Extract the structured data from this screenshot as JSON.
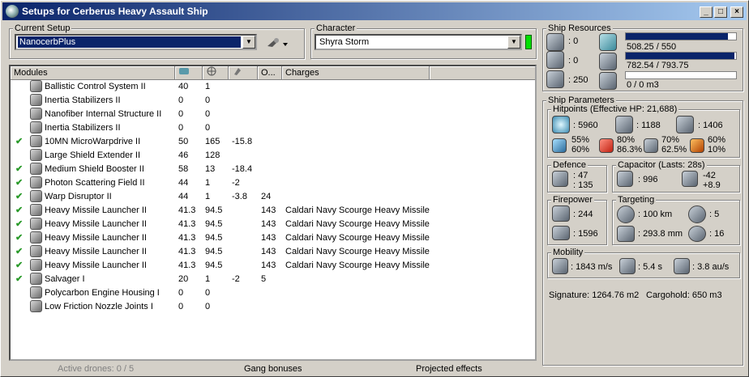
{
  "window": {
    "title": "Setups for Cerberus Heavy Assault Ship",
    "min": "_",
    "max": "□",
    "close": "×"
  },
  "setup": {
    "label": "Current Setup",
    "value": "NanocerbPlus"
  },
  "character": {
    "label": "Character",
    "value": "Shyra Storm"
  },
  "columns": {
    "modules": "Modules",
    "c1": "",
    "c2": "",
    "c3": "",
    "c4": "O...",
    "charges": "Charges"
  },
  "modules": [
    {
      "check": "",
      "name": "Ballistic Control System II",
      "cpu": "40",
      "pg": "1",
      "cap": "",
      "opt": "",
      "charge": ""
    },
    {
      "check": "",
      "name": "Inertia Stabilizers II",
      "cpu": "0",
      "pg": "0",
      "cap": "",
      "opt": "",
      "charge": ""
    },
    {
      "check": "",
      "name": "Nanofiber Internal Structure II",
      "cpu": "0",
      "pg": "0",
      "cap": "",
      "opt": "",
      "charge": ""
    },
    {
      "check": "",
      "name": "Inertia Stabilizers II",
      "cpu": "0",
      "pg": "0",
      "cap": "",
      "opt": "",
      "charge": ""
    },
    {
      "check": "✔",
      "name": "10MN MicroWarpdrive II",
      "cpu": "50",
      "pg": "165",
      "cap": "-15.8",
      "opt": "",
      "charge": ""
    },
    {
      "check": "",
      "name": "Large Shield Extender II",
      "cpu": "46",
      "pg": "128",
      "cap": "",
      "opt": "",
      "charge": ""
    },
    {
      "check": "✔",
      "name": "Medium Shield Booster II",
      "cpu": "58",
      "pg": "13",
      "cap": "-18.4",
      "opt": "",
      "charge": ""
    },
    {
      "check": "✔",
      "name": "Photon Scattering Field II",
      "cpu": "44",
      "pg": "1",
      "cap": "-2",
      "opt": "",
      "charge": ""
    },
    {
      "check": "✔",
      "name": "Warp Disruptor II",
      "cpu": "44",
      "pg": "1",
      "cap": "-3.8",
      "opt": "24",
      "charge": ""
    },
    {
      "check": "✔",
      "name": "Heavy Missile Launcher II",
      "cpu": "41.3",
      "pg": "94.5",
      "cap": "",
      "opt": "143",
      "charge": "Caldari Navy Scourge Heavy Missile"
    },
    {
      "check": "✔",
      "name": "Heavy Missile Launcher II",
      "cpu": "41.3",
      "pg": "94.5",
      "cap": "",
      "opt": "143",
      "charge": "Caldari Navy Scourge Heavy Missile"
    },
    {
      "check": "✔",
      "name": "Heavy Missile Launcher II",
      "cpu": "41.3",
      "pg": "94.5",
      "cap": "",
      "opt": "143",
      "charge": "Caldari Navy Scourge Heavy Missile"
    },
    {
      "check": "✔",
      "name": "Heavy Missile Launcher II",
      "cpu": "41.3",
      "pg": "94.5",
      "cap": "",
      "opt": "143",
      "charge": "Caldari Navy Scourge Heavy Missile"
    },
    {
      "check": "✔",
      "name": "Heavy Missile Launcher II",
      "cpu": "41.3",
      "pg": "94.5",
      "cap": "",
      "opt": "143",
      "charge": "Caldari Navy Scourge Heavy Missile"
    },
    {
      "check": "✔",
      "name": "Salvager I",
      "cpu": "20",
      "pg": "1",
      "cap": "-2",
      "opt": "5",
      "charge": ""
    },
    {
      "check": "",
      "name": "Polycarbon Engine Housing I",
      "cpu": "0",
      "pg": "0",
      "cap": "",
      "opt": "",
      "charge": ""
    },
    {
      "check": "",
      "name": "Low Friction Nozzle Joints I",
      "cpu": "0",
      "pg": "0",
      "cap": "",
      "opt": "",
      "charge": ""
    }
  ],
  "status": {
    "drones": "Active drones: 0 / 5",
    "gang": "Gang bonuses",
    "projected": "Projected effects"
  },
  "resources": {
    "label": "Ship Resources",
    "hi": ": 0",
    "med": ": 0",
    "low": ": 250",
    "cpu": "508.25 / 550",
    "cpu_frac": 0.924,
    "pg": "782.54 / 793.75",
    "pg_frac": 0.986,
    "drone": "0 / 0 m3",
    "drone_frac": 0
  },
  "params": {
    "label": "Ship Parameters",
    "hp": {
      "label": "Hitpoints (Effective HP: 21,688)",
      "shield": ": 5960",
      "armor": ": 1188",
      "hull": ": 1406",
      "r1a": "55%",
      "r1b": "60%",
      "r2a": "80%",
      "r2b": "86.3%",
      "r3a": "70%",
      "r3b": "62.5%",
      "r4a": "60%",
      "r4b": "10%"
    },
    "defence": {
      "label": "Defence",
      "a": ": 47",
      "b": ": 135"
    },
    "cap": {
      "label": "Capacitor (Lasts: 28s)",
      "amount": ": 996",
      "delta1": "-42",
      "delta2": "+8.9"
    },
    "fire": {
      "label": "Firepower",
      "dps": ": 244",
      "volley": ": 1596"
    },
    "target": {
      "label": "Targeting",
      "range": ": 100 km",
      "res": ": 293.8 mm",
      "targets": ": 5",
      "sensor": ": 16"
    },
    "mob": {
      "label": "Mobility",
      "speed": ": 1843 m/s",
      "align": ": 5.4 s",
      "warp": ": 3.8 au/s"
    },
    "sig": "Signature: 1264.76 m2",
    "cargo": "Cargohold: 650 m3"
  }
}
